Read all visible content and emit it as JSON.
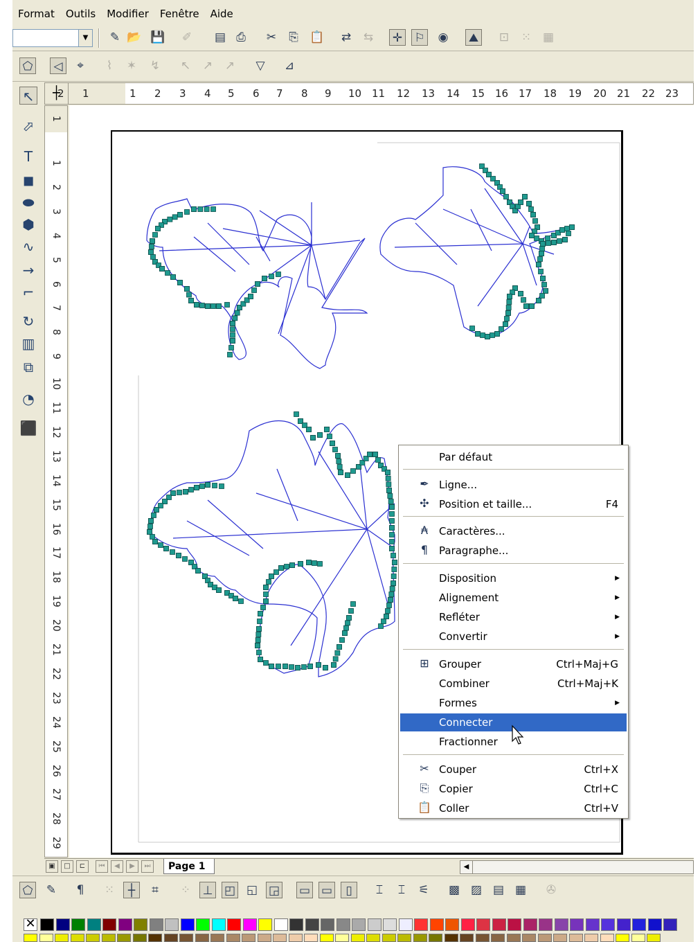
{
  "menubar": [
    "Format",
    "Outils",
    "Modifier",
    "Fenêtre",
    "Aide"
  ],
  "hruler_numbers": [
    "2",
    "1",
    "1",
    "2",
    "3",
    "4",
    "5",
    "6",
    "7",
    "8",
    "9",
    "10",
    "11",
    "12",
    "13",
    "14",
    "15",
    "16",
    "17",
    "18",
    "19",
    "20",
    "21",
    "22",
    "23"
  ],
  "vruler_numbers": [
    "1",
    "1",
    "2",
    "3",
    "4",
    "5",
    "6",
    "7",
    "8",
    "9",
    "10",
    "11",
    "12",
    "13",
    "14",
    "15",
    "16",
    "17",
    "18",
    "19",
    "20",
    "21",
    "22",
    "23",
    "24",
    "25",
    "26",
    "27",
    "28",
    "29"
  ],
  "page_tab": "Page 1",
  "context_menu": {
    "par_defaut": "Par défaut",
    "ligne": "Ligne...",
    "position": {
      "label": "Position et taille...",
      "shortcut": "F4"
    },
    "caracteres": "Caractères...",
    "paragraphe": "Paragraphe...",
    "disposition": "Disposition",
    "alignement": "Alignement",
    "refleter": "Refléter",
    "convertir": "Convertir",
    "grouper": {
      "label": "Grouper",
      "shortcut": "Ctrl+Maj+G"
    },
    "combiner": {
      "label": "Combiner",
      "shortcut": "Ctrl+Maj+K"
    },
    "formes": "Formes",
    "connecter": "Connecter",
    "fractionner": "Fractionner",
    "couper": {
      "label": "Couper",
      "shortcut": "Ctrl+X"
    },
    "copier": {
      "label": "Copier",
      "shortcut": "Ctrl+C"
    },
    "coller": {
      "label": "Coller",
      "shortcut": "Ctrl+V"
    }
  },
  "colors": {
    "selection_handles": "#1f9a8f",
    "leaf_stroke": "#2a2fd1",
    "menu_highlight": "#3169c6"
  },
  "palette": [
    "#000000",
    "#000080",
    "#008000",
    "#008080",
    "#800000",
    "#800080",
    "#808000",
    "#808080",
    "#c0c0c0",
    "#0000ff",
    "#00ff00",
    "#00ffff",
    "#ff0000",
    "#ff00ff",
    "#ffff00",
    "#ffffff",
    "#333333",
    "#444444",
    "#666666",
    "#888888",
    "#aaaaaa",
    "#cccccc",
    "#dddddd",
    "#eeeeff",
    "#ff3333",
    "#ff4400",
    "#ee5500",
    "#ff2244",
    "#dd3344",
    "#cc2244",
    "#bb1144",
    "#aa2266",
    "#993388",
    "#8844aa",
    "#7733bb",
    "#6633cc",
    "#5533dd",
    "#4422cc",
    "#2222dd",
    "#1111cc",
    "#3322bb"
  ]
}
